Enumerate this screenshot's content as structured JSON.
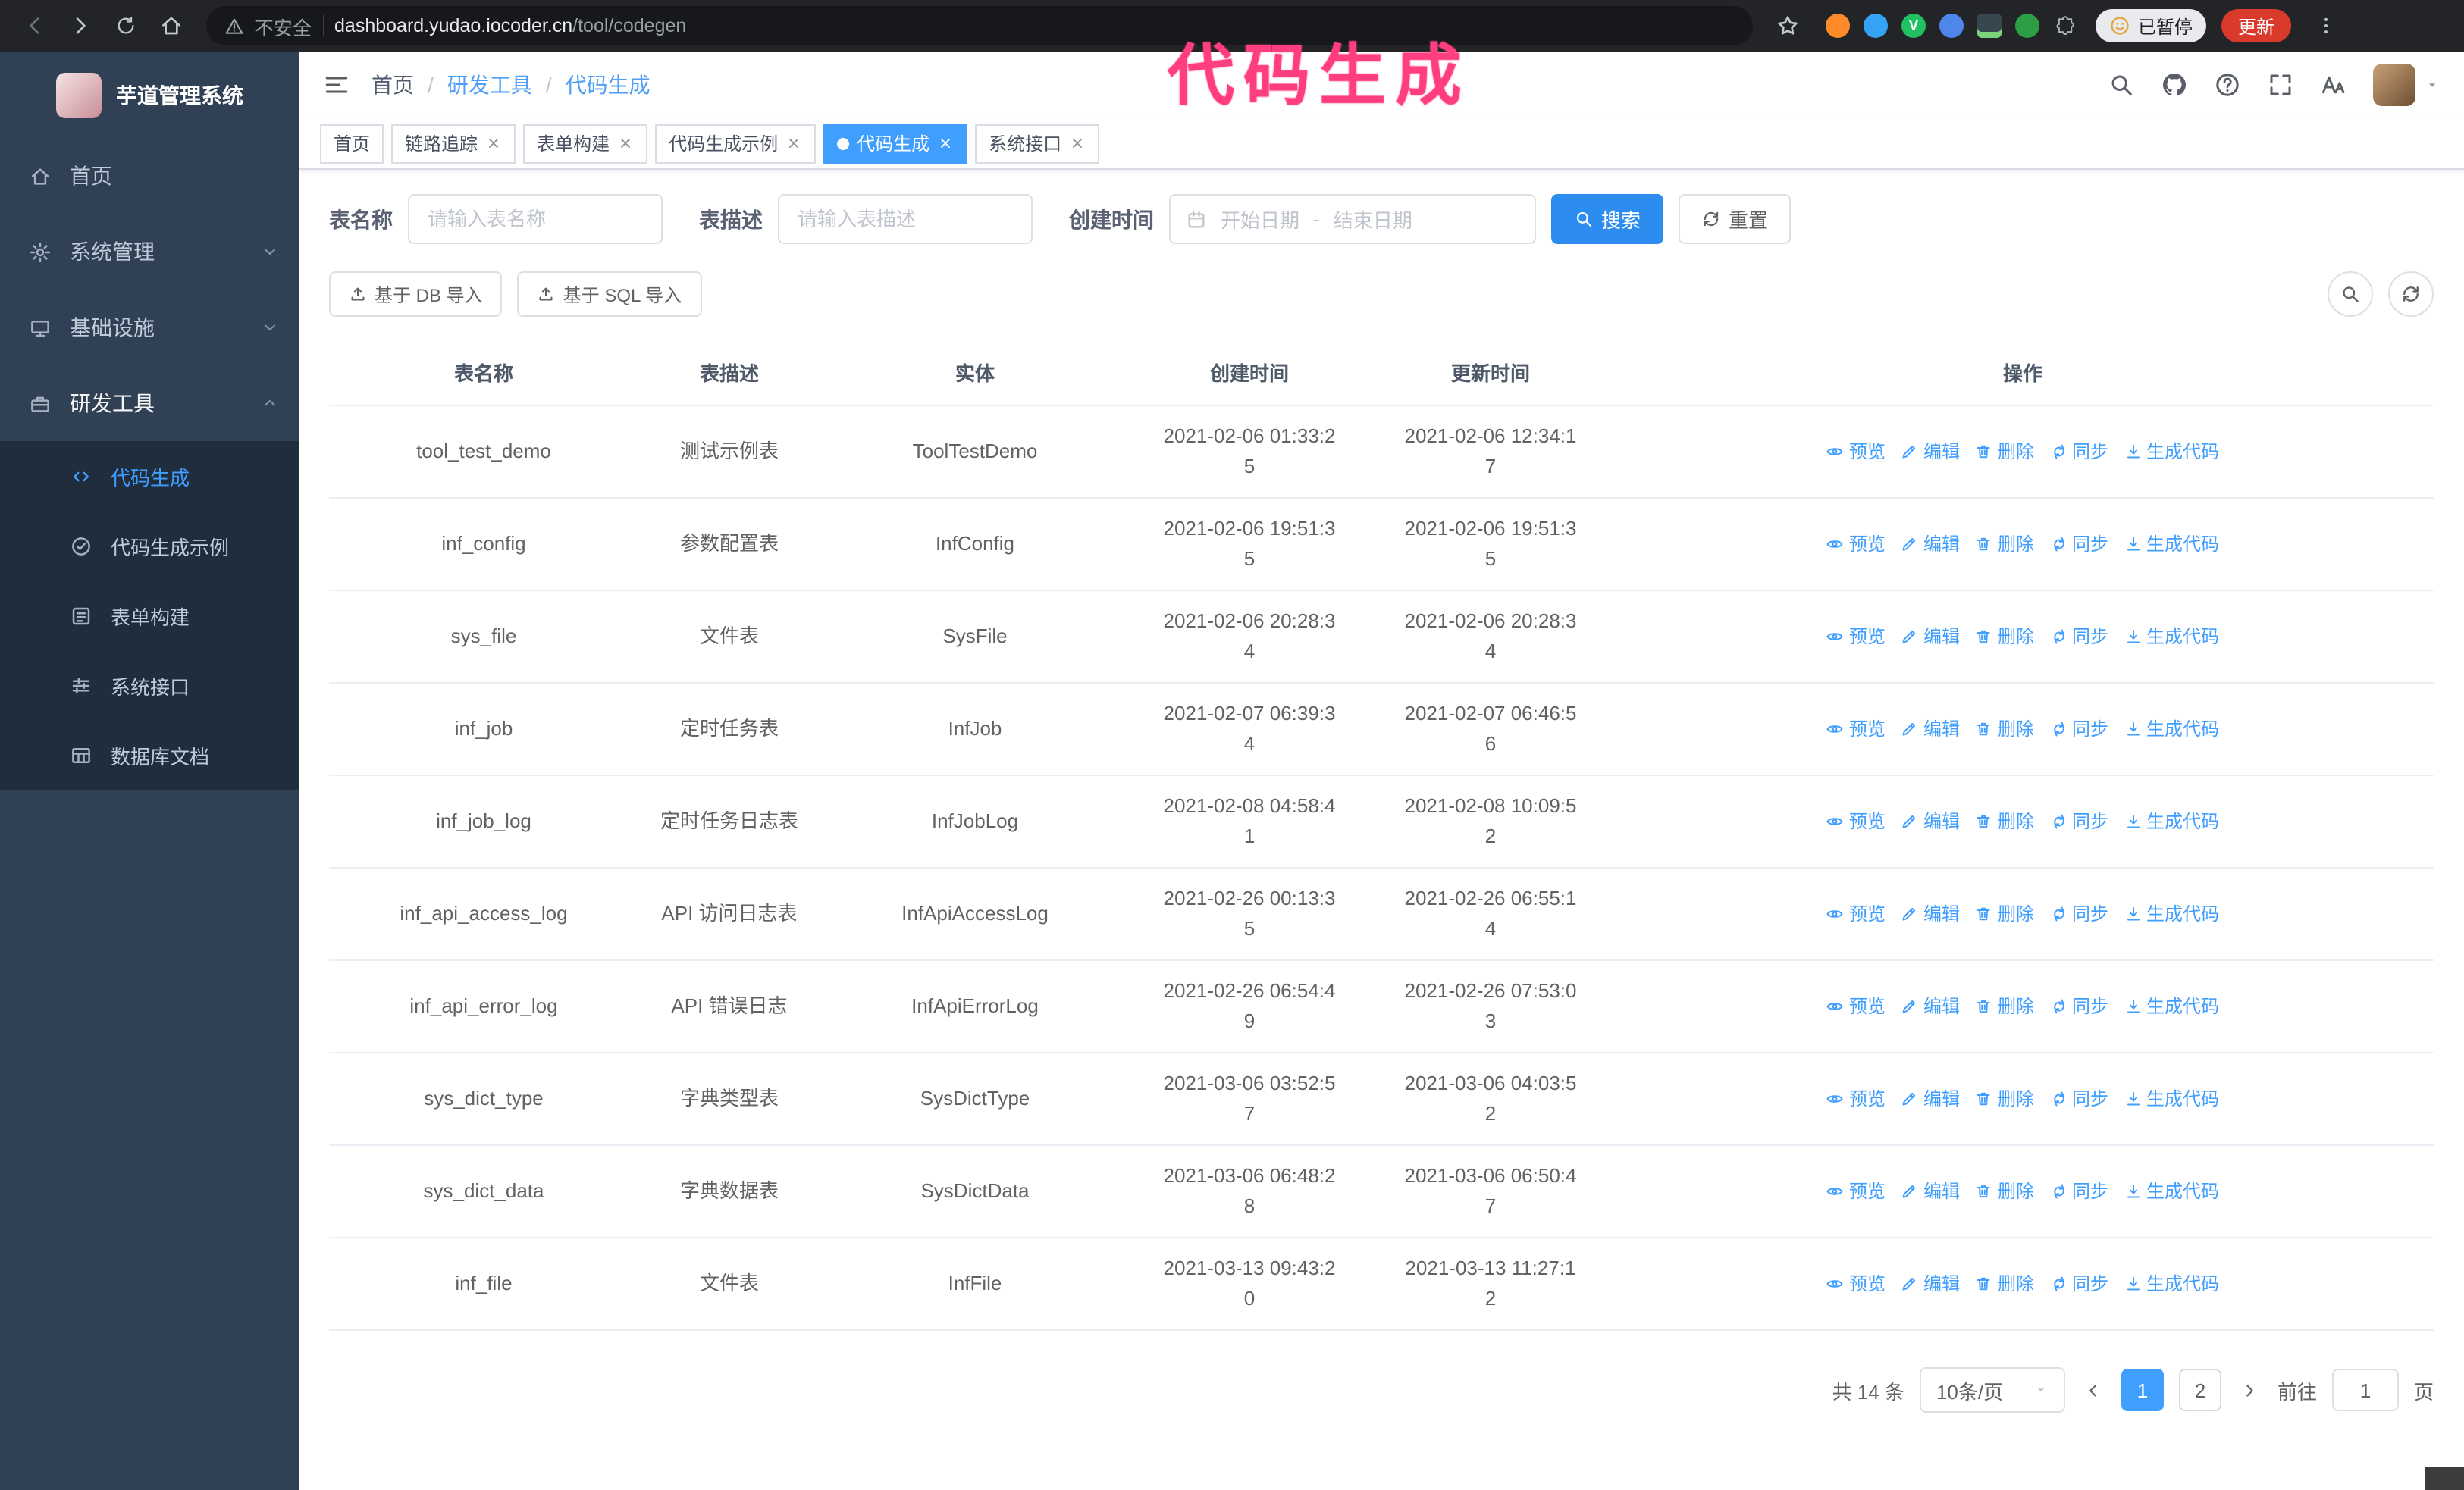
{
  "browser": {
    "security_label": "不安全",
    "url_host": "dashboard.yudao.iocoder.cn",
    "url_path": "/tool/codegen",
    "paused_badge": "已暂停",
    "update_button": "更新",
    "extension_check_letter": "V"
  },
  "annotation": {
    "text": "代码生成",
    "color": "#ff3e7f"
  },
  "colors": {
    "accent": "#409eff",
    "sidebar_bg": "#304156",
    "submenu_bg": "#1f2d3d",
    "update_button_red": "#d93a2b",
    "primary_button": "#2d8cf0"
  },
  "sidebar": {
    "logo_title": "芋道管理系统",
    "items": [
      {
        "label": "首页"
      },
      {
        "label": "系统管理"
      },
      {
        "label": "基础设施"
      },
      {
        "label": "研发工具"
      }
    ],
    "submenu": [
      {
        "label": "代码生成"
      },
      {
        "label": "代码生成示例"
      },
      {
        "label": "表单构建"
      },
      {
        "label": "系统接口"
      },
      {
        "label": "数据库文档"
      }
    ]
  },
  "header": {
    "breadcrumb": [
      "首页",
      "研发工具",
      "代码生成"
    ],
    "separator": "/"
  },
  "tabs": [
    {
      "label": "首页"
    },
    {
      "label": "链路追踪"
    },
    {
      "label": "表单构建"
    },
    {
      "label": "代码生成示例"
    },
    {
      "label": "代码生成"
    },
    {
      "label": "系统接口"
    }
  ],
  "filters": {
    "table_name_label": "表名称",
    "table_name_placeholder": "请输入表名称",
    "table_desc_label": "表描述",
    "table_desc_placeholder": "请输入表描述",
    "create_time_label": "创建时间",
    "date_start_placeholder": "开始日期",
    "date_separator": "-",
    "date_end_placeholder": "结束日期",
    "search_button": "搜索",
    "reset_button": "重置"
  },
  "toolbar": {
    "import_db": "基于 DB 导入",
    "import_sql": "基于 SQL 导入"
  },
  "table": {
    "columns": [
      "表名称",
      "表描述",
      "实体",
      "创建时间",
      "更新时间",
      "操作"
    ],
    "actions": [
      "预览",
      "编辑",
      "删除",
      "同步",
      "生成代码"
    ],
    "rows": [
      {
        "name": "tool_test_demo",
        "desc": "测试示例表",
        "entity": "ToolTestDemo",
        "created": "2021-02-06 01:33:25",
        "updated": "2021-02-06 12:34:17"
      },
      {
        "name": "inf_config",
        "desc": "参数配置表",
        "entity": "InfConfig",
        "created": "2021-02-06 19:51:35",
        "updated": "2021-02-06 19:51:35"
      },
      {
        "name": "sys_file",
        "desc": "文件表",
        "entity": "SysFile",
        "created": "2021-02-06 20:28:34",
        "updated": "2021-02-06 20:28:34"
      },
      {
        "name": "inf_job",
        "desc": "定时任务表",
        "entity": "InfJob",
        "created": "2021-02-07 06:39:34",
        "updated": "2021-02-07 06:46:56"
      },
      {
        "name": "inf_job_log",
        "desc": "定时任务日志表",
        "entity": "InfJobLog",
        "created": "2021-02-08 04:58:41",
        "updated": "2021-02-08 10:09:52"
      },
      {
        "name": "inf_api_access_log",
        "desc": "API 访问日志表",
        "entity": "InfApiAccessLog",
        "created": "2021-02-26 00:13:35",
        "updated": "2021-02-26 06:55:14"
      },
      {
        "name": "inf_api_error_log",
        "desc": "API 错误日志",
        "entity": "InfApiErrorLog",
        "created": "2021-02-26 06:54:49",
        "updated": "2021-02-26 07:53:03"
      },
      {
        "name": "sys_dict_type",
        "desc": "字典类型表",
        "entity": "SysDictType",
        "created": "2021-03-06 03:52:57",
        "updated": "2021-03-06 04:03:52"
      },
      {
        "name": "sys_dict_data",
        "desc": "字典数据表",
        "entity": "SysDictData",
        "created": "2021-03-06 06:48:28",
        "updated": "2021-03-06 06:50:47"
      },
      {
        "name": "inf_file",
        "desc": "文件表",
        "entity": "InfFile",
        "created": "2021-03-13 09:43:20",
        "updated": "2021-03-13 11:27:12"
      }
    ]
  },
  "pagination": {
    "total": "共 14 条",
    "page_size": "10条/页",
    "pages": [
      "1",
      "2"
    ],
    "goto_label": "前往",
    "goto_value": "1",
    "goto_suffix": "页"
  }
}
